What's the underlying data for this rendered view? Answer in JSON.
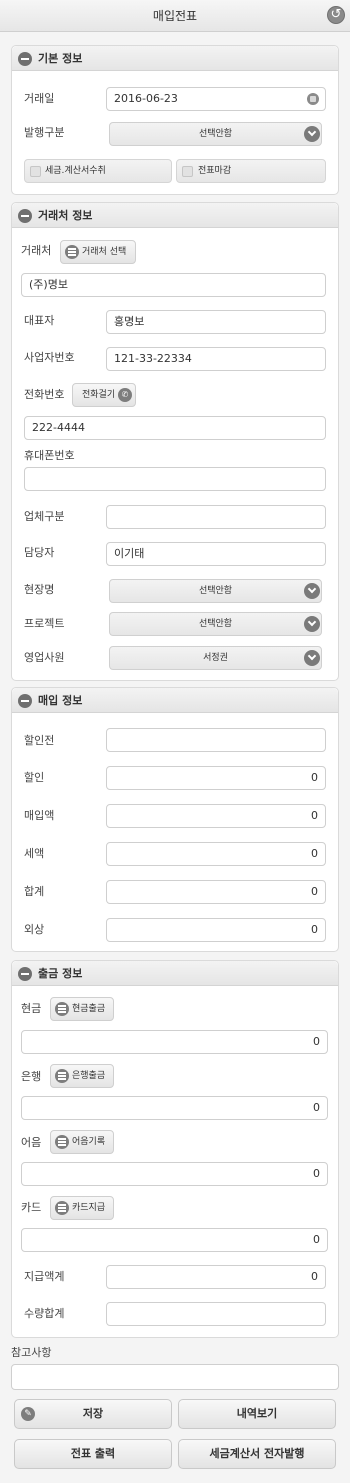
{
  "header": {
    "title": "매입전표"
  },
  "basic": {
    "title": "기본 정보",
    "date_label": "거래일",
    "date_value": "2016-06-23",
    "issue_label": "발행구분",
    "issue_value": "선택안함",
    "chk_tax": "세금.계산서수취",
    "chk_close": "전표마감"
  },
  "partner": {
    "title": "거래처 정보",
    "partner_label": "거래처",
    "partner_btn": "거래처 선택",
    "partner_value": "(주)명보",
    "ceo_label": "대표자",
    "ceo_value": "홍명보",
    "bizno_label": "사업자번호",
    "bizno_value": "121-33-22334",
    "phone_label": "전화번호",
    "phone_btn": "전화걸기",
    "phone_value": "222-4444",
    "mobile_label": "휴대폰번호",
    "mobile_value": "",
    "biztype_label": "업체구분",
    "biztype_value": "",
    "manager_label": "담당자",
    "manager_value": "이기태",
    "site_label": "현장명",
    "site_value": "선택안함",
    "project_label": "프로젝트",
    "project_value": "선택안함",
    "sales_label": "영업사원",
    "sales_value": "서정권"
  },
  "purchase": {
    "title": "매입 정보",
    "before_label": "할인전",
    "before_value": "",
    "discount_label": "할인",
    "discount_value": "0",
    "amount_label": "매입액",
    "amount_value": "0",
    "tax_label": "세액",
    "tax_value": "0",
    "total_label": "합계",
    "total_value": "0",
    "credit_label": "외상",
    "credit_value": "0"
  },
  "payment": {
    "title": "출금 정보",
    "cash_label": "현금",
    "cash_btn": "현금출금",
    "cash_value": "0",
    "bank_label": "은행",
    "bank_btn": "은행출금",
    "bank_value": "0",
    "note_label": "어음",
    "note_btn": "어음기록",
    "note_value": "0",
    "card_label": "카드",
    "card_btn": "카드지급",
    "card_value": "0",
    "paytotal_label": "지급액계",
    "paytotal_value": "0",
    "qty_label": "수량합계",
    "qty_value": ""
  },
  "remarks": {
    "label": "참고사항",
    "value": ""
  },
  "actions": {
    "save": "저장",
    "history": "내역보기",
    "print": "전표 출력",
    "etax": "세금계산서 전자발행"
  }
}
